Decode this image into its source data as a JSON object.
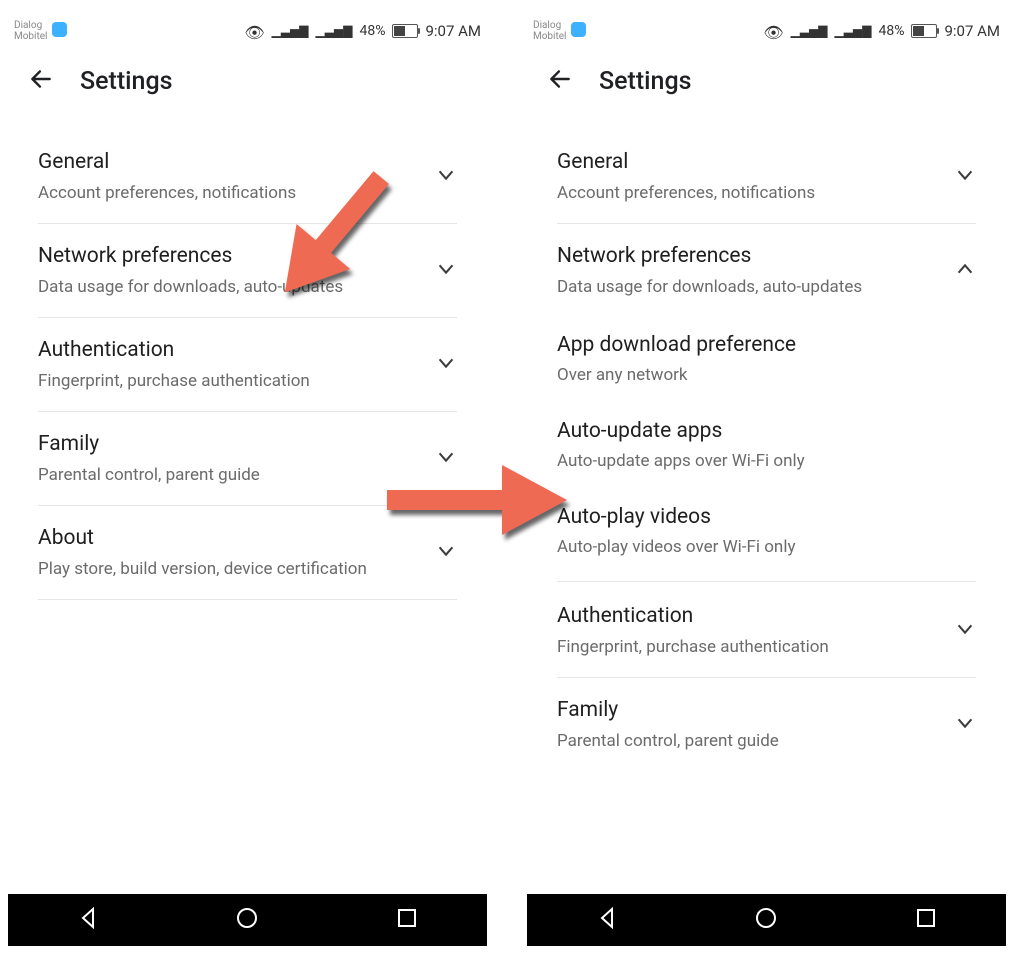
{
  "status": {
    "carrier1": "Dialog",
    "carrier2": "Mobitel",
    "battery_pct": "48%",
    "clock": "9:07 AM"
  },
  "header": {
    "title": "Settings"
  },
  "left_screen": {
    "items": [
      {
        "title": "General",
        "sub": "Account preferences, notifications",
        "chev": "down"
      },
      {
        "title": "Network preferences",
        "sub": "Data usage for downloads, auto-updates",
        "chev": "down"
      },
      {
        "title": "Authentication",
        "sub": "Fingerprint, purchase authentication",
        "chev": "down"
      },
      {
        "title": "Family",
        "sub": "Parental control, parent guide",
        "chev": "down"
      },
      {
        "title": "About",
        "sub": "Play store, build version, device certification",
        "chev": "down"
      }
    ]
  },
  "right_screen": {
    "items": [
      {
        "title": "General",
        "sub": "Account preferences, notifications",
        "chev": "down"
      },
      {
        "title": "Network preferences",
        "sub": "Data usage for downloads, auto-updates",
        "chev": "up",
        "expanded": [
          {
            "title": "App download preference",
            "sub": "Over any network"
          },
          {
            "title": "Auto-update apps",
            "sub": "Auto-update apps over Wi-Fi only"
          },
          {
            "title": "Auto-play videos",
            "sub": "Auto-play videos over Wi-Fi only"
          }
        ]
      },
      {
        "title": "Authentication",
        "sub": "Fingerprint, purchase authentication",
        "chev": "down"
      },
      {
        "title": "Family",
        "sub": "Parental control, parent guide",
        "chev": "down"
      }
    ]
  }
}
